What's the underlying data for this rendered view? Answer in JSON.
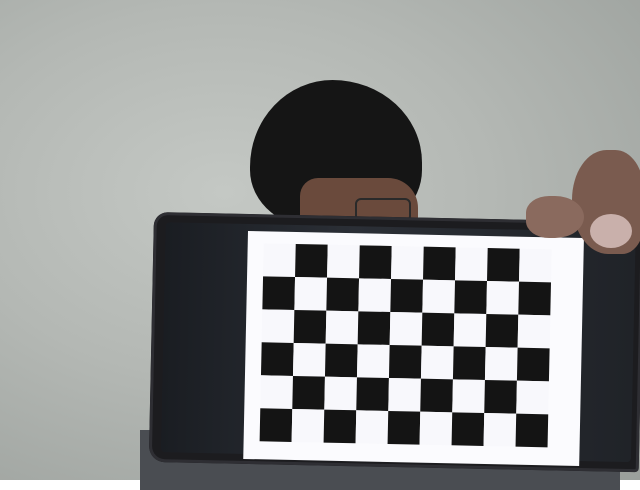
{
  "scene": {
    "description_label": "photo",
    "colors": {
      "wall": "#b4b8b4",
      "hair": "#151515",
      "skin": "#7a5b4f",
      "phone_body": "#1c1c1f",
      "board_dark": "#141414",
      "board_light": "#f8f8fc"
    }
  },
  "checkerboard": {
    "columns": 9,
    "rows": 6
  }
}
